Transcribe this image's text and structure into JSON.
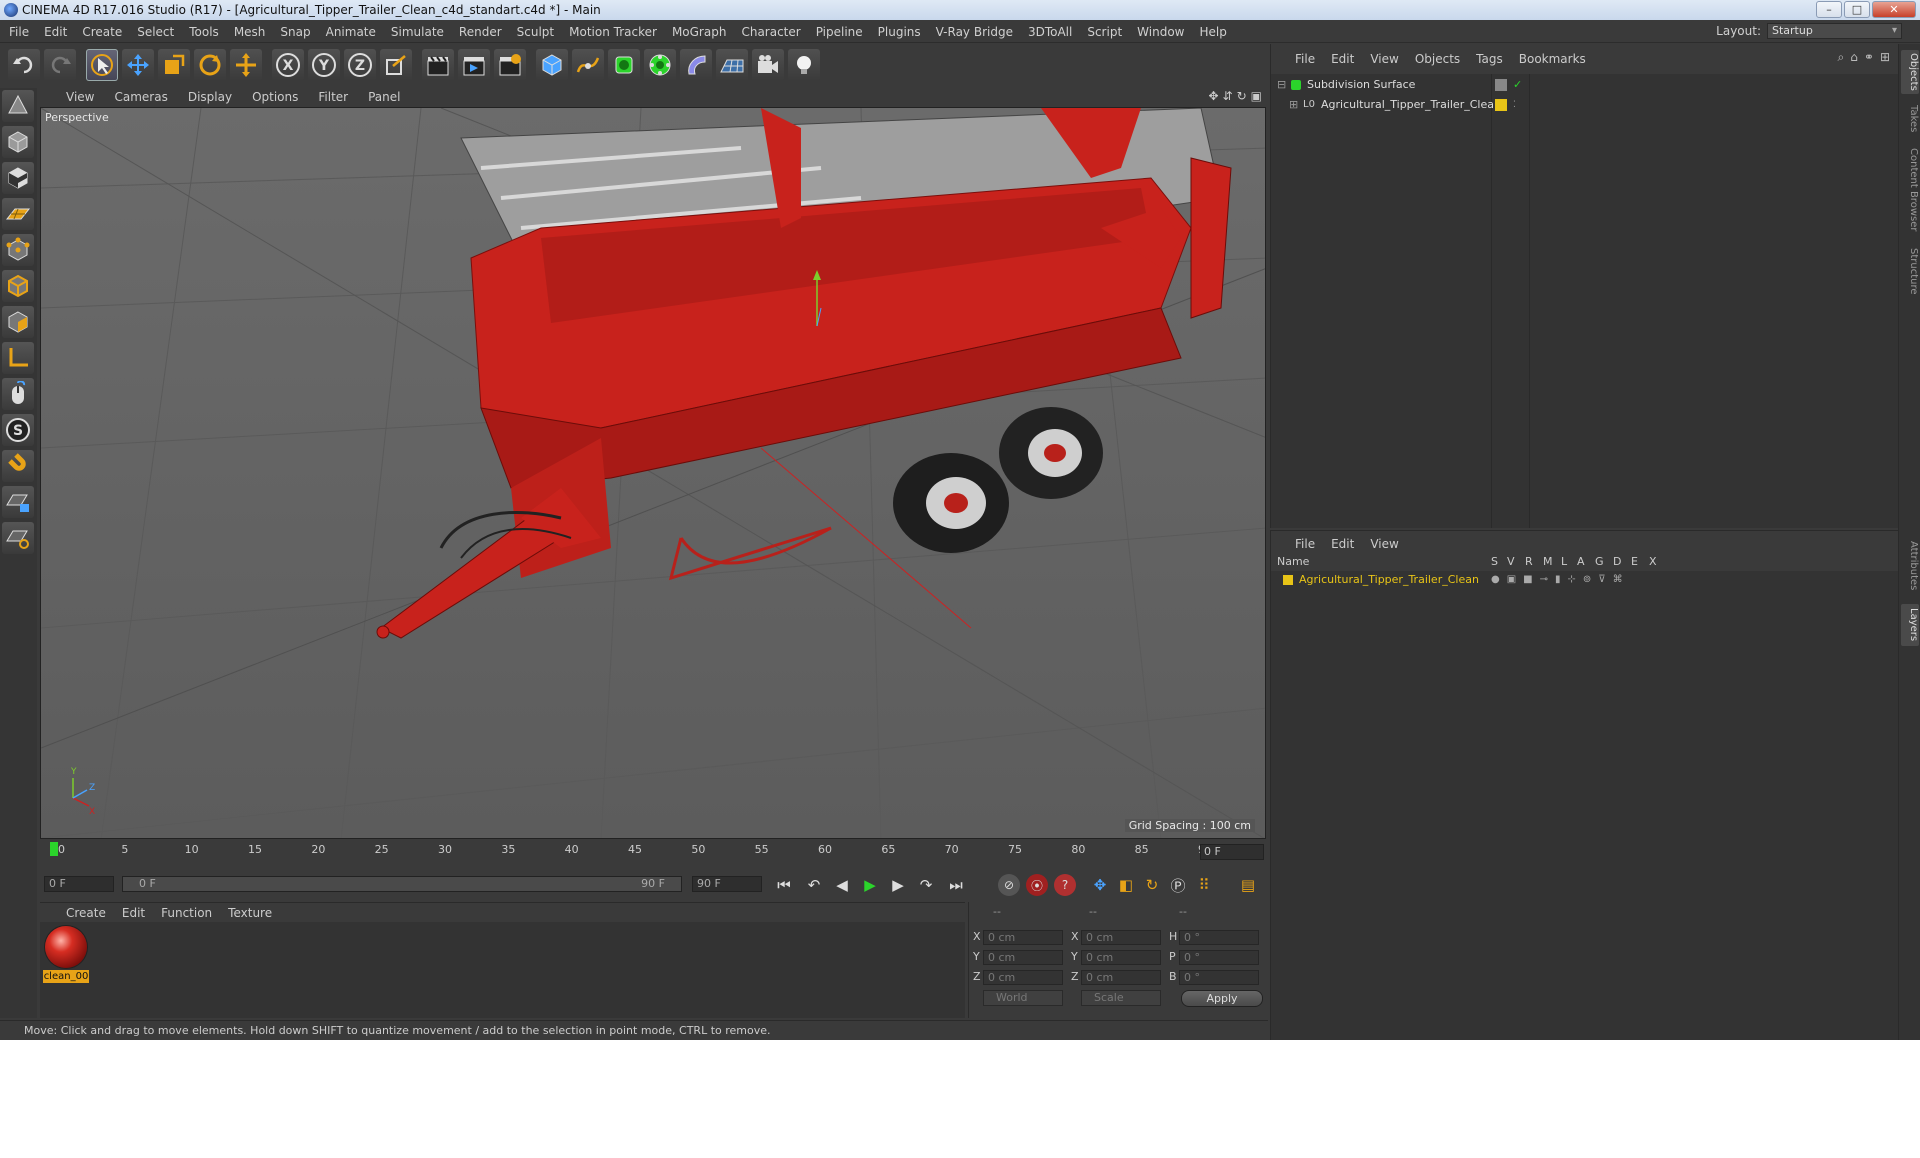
{
  "window": {
    "title": "CINEMA 4D R17.016 Studio (R17) - [Agricultural_Tipper_Trailer_Clean_c4d_standart.c4d *] - Main",
    "buttons": [
      "–",
      "□",
      "✕"
    ]
  },
  "menubar": {
    "items": [
      "File",
      "Edit",
      "Create",
      "Select",
      "Tools",
      "Mesh",
      "Snap",
      "Animate",
      "Simulate",
      "Render",
      "Sculpt",
      "Motion Tracker",
      "MoGraph",
      "Character",
      "Pipeline",
      "Plugins",
      "V-Ray Bridge",
      "3DToAll",
      "Script",
      "Window",
      "Help"
    ],
    "layout_label": "Layout:",
    "layout_value": "Startup"
  },
  "toolbar": {
    "axis_labels": [
      "X",
      "Y",
      "Z"
    ]
  },
  "viewport": {
    "menu": [
      "View",
      "Cameras",
      "Display",
      "Options",
      "Filter",
      "Panel"
    ],
    "camera_label": "Perspective",
    "grid_spacing": "Grid Spacing : 100 cm"
  },
  "timeline": {
    "ticks": [
      "0",
      "5",
      "10",
      "15",
      "20",
      "25",
      "30",
      "35",
      "40",
      "45",
      "50",
      "55",
      "60",
      "65",
      "70",
      "75",
      "80",
      "85",
      "90"
    ],
    "current_frame": "0 F",
    "start_field": "0 F",
    "range_start": "0 F",
    "range_end": "90 F",
    "end_field": "90 F"
  },
  "material_manager": {
    "menu": [
      "Create",
      "Edit",
      "Function",
      "Texture"
    ],
    "material_name": "clean_00"
  },
  "coordinates": {
    "headers": [
      "--",
      "--",
      "--"
    ],
    "rows": [
      {
        "a": "X",
        "av": "0 cm",
        "b": "X",
        "bv": "0 cm",
        "c": "H",
        "cv": "0 °"
      },
      {
        "a": "Y",
        "av": "0 cm",
        "b": "Y",
        "bv": "0 cm",
        "c": "P",
        "cv": "0 °"
      },
      {
        "a": "Z",
        "av": "0 cm",
        "b": "Z",
        "bv": "0 cm",
        "c": "B",
        "cv": "0 °"
      }
    ],
    "mode": "World",
    "scale": "Scale",
    "apply": "Apply"
  },
  "status": "Move: Click and drag to move elements. Hold down SHIFT to quantize movement / add to the selection in point mode, CTRL to remove.",
  "object_manager": {
    "menu": [
      "File",
      "Edit",
      "View",
      "Objects",
      "Tags",
      "Bookmarks"
    ],
    "objects": [
      {
        "name": "Subdivision Surface"
      },
      {
        "name": "Agricultural_Tipper_Trailer_Clean"
      }
    ]
  },
  "layer_manager": {
    "menu": [
      "File",
      "Edit",
      "View"
    ],
    "name_header": "Name",
    "columns": [
      "S",
      "V",
      "R",
      "M",
      "L",
      "A",
      "G",
      "D",
      "E",
      "X"
    ],
    "layers": [
      {
        "name": "Agricultural_Tipper_Trailer_Clean",
        "color": "#e8c417"
      }
    ]
  },
  "side_tabs": [
    "Objects",
    "Takes",
    "Content Browser",
    "Structure",
    "Attributes",
    "Layers"
  ],
  "colors": {
    "trailer_red": "#c8221c",
    "selection_orange": "#e8a317",
    "active_green": "#2bd42b"
  }
}
